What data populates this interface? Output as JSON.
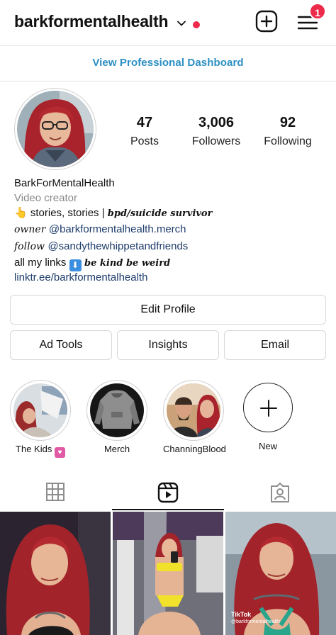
{
  "header": {
    "username": "barkformentalhealth",
    "notification_count": "1"
  },
  "dashboard_link": "View Professional Dashboard",
  "stats": [
    {
      "value": "47",
      "label": "Posts"
    },
    {
      "value": "3,006",
      "label": "Followers"
    },
    {
      "value": "92",
      "label": "Following"
    }
  ],
  "bio": {
    "name": "BarkForMentalHealth",
    "category": "Video creator",
    "line1_emoji": "👆",
    "line1_text": "stories, stories | ",
    "line1_fancy": "bpd/suicide survivor",
    "line2_fancy": "owner ",
    "line2_mention": "@barkformentalhealth.merch",
    "line3_fancy": "follow ",
    "line3_mention": "@sandythewhippetandfriends",
    "line4_text": "all my links ",
    "line4_emoji": "⬇",
    "line4_fancy": " be kind be weird",
    "link": "linktr.ee/barkformentalhealth"
  },
  "buttons": {
    "edit_profile": "Edit Profile",
    "ad_tools": "Ad Tools",
    "insights": "Insights",
    "email": "Email"
  },
  "highlights": [
    {
      "label": "The Kids",
      "emoji": "💟"
    },
    {
      "label": "Merch"
    },
    {
      "label": "ChanningBlood"
    },
    {
      "label": "New"
    }
  ],
  "tabs": [
    {
      "name": "grid-icon"
    },
    {
      "name": "reels-icon",
      "active": true
    },
    {
      "name": "tagged-icon"
    }
  ],
  "grid_overlay": {
    "tiktok_label": "TikTok",
    "tiktok_handle": "@barkformentalhealth"
  },
  "colors": {
    "accent_link": "#2a8fc4",
    "mention": "#1e3d6b",
    "notification": "#ee2a4a",
    "hair": "#b0262a"
  }
}
